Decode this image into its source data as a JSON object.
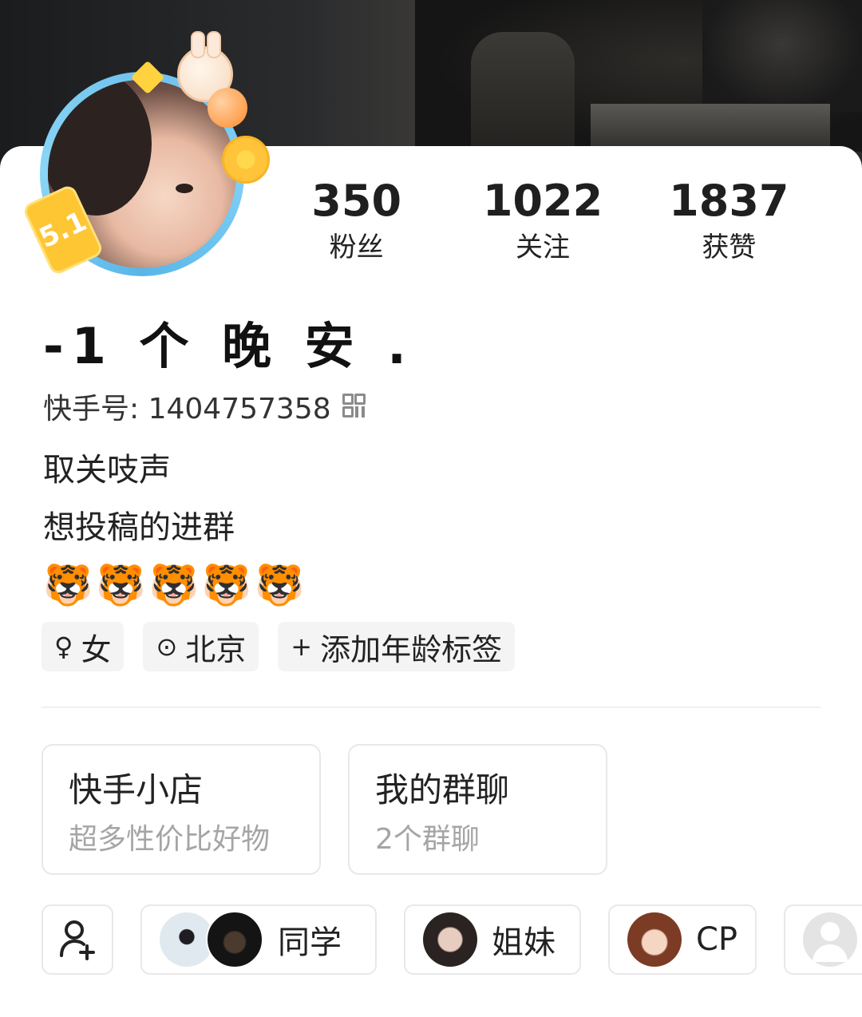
{
  "stats": [
    {
      "value": "350",
      "label": "粉丝"
    },
    {
      "value": "1022",
      "label": "关注"
    },
    {
      "value": "1837",
      "label": "获赞"
    }
  ],
  "avatar_badge": "5.1",
  "profile": {
    "name": "-1 个 晚 安 .",
    "kuaishou_id": "快手号: 1404757358",
    "bio_line1": "取关吱声",
    "bio_line2": "想投稿的进群",
    "bio_emojis": "🐯🐯🐯🐯🐯"
  },
  "tags": {
    "gender": "女",
    "location": "北京",
    "add_age": "添加年龄标签"
  },
  "cards": {
    "shop_title": "快手小店",
    "shop_sub": "超多性价比好物",
    "group_title": "我的群聊",
    "group_sub": "2个群聊"
  },
  "chips": {
    "classmates": "同学",
    "sisters": "姐妹",
    "cp": "CP"
  }
}
